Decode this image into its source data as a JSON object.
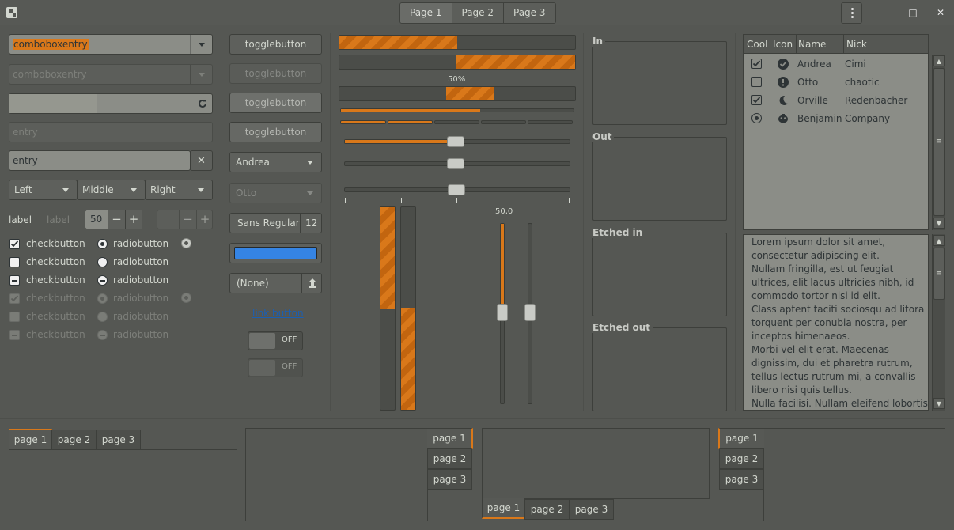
{
  "header": {
    "stack_tabs": [
      "Page 1",
      "Page 2",
      "Page 3"
    ],
    "window_buttons": {
      "minimize": "–",
      "maximize": "□",
      "close": "✕"
    }
  },
  "col1": {
    "combo1": "comboboxentry",
    "combo2": "comboboxentry",
    "entry_disabled": "entry",
    "entry_clear": "entry",
    "linked": [
      "Left",
      "Middle",
      "Right"
    ],
    "label1": "label",
    "label2": "label",
    "spin_value": "50",
    "spin_minus": "−",
    "spin_plus": "+",
    "checks": [
      "checkbutton",
      "checkbutton",
      "checkbutton",
      "checkbutton",
      "checkbutton",
      "checkbutton"
    ],
    "radios": [
      "radiobutton",
      "radiobutton",
      "radiobutton",
      "radiobutton",
      "radiobutton",
      "radiobutton"
    ]
  },
  "col2": {
    "toggles": [
      "togglebutton",
      "togglebutton",
      "togglebutton",
      "togglebutton"
    ],
    "combo_andrea": "Andrea",
    "combo_otto": "Otto",
    "font_name": "Sans Regular",
    "font_size": "12",
    "color_hex": "#3584e4",
    "file_none": "(None)",
    "link": "link button",
    "switch1": "OFF",
    "switch2": "OFF"
  },
  "col3": {
    "progress_label": "50%",
    "progress_top": 0.5,
    "vscale_label": "50,0"
  },
  "frames": [
    "In",
    "Out",
    "Etched in",
    "Etched out"
  ],
  "tree": {
    "columns": [
      "Cool",
      "Icon",
      "Name",
      "Nick"
    ],
    "rows": [
      {
        "cool": "check",
        "icon": "check-circle-icon",
        "name": "Andrea",
        "nick": "Cimi"
      },
      {
        "cool": "empty",
        "icon": "alert-circle-icon",
        "name": "Otto",
        "nick": "chaotic"
      },
      {
        "cool": "check",
        "icon": "moon-icon",
        "name": "Orville",
        "nick": "Redenbacher"
      },
      {
        "cool": "radio",
        "icon": "face-icon",
        "name": "Benjamin",
        "nick": "Company"
      }
    ]
  },
  "text_lines": [
    "Lorem ipsum dolor sit amet,",
    "consectetur adipiscing elit.",
    "Nullam fringilla, est ut feugiat",
    "ultrices, elit lacus ultricies nibh, id",
    "commodo tortor nisi id elit.",
    "Class aptent taciti sociosqu ad litora",
    "torquent per conubia nostra, per",
    "inceptos himenaeos.",
    "Morbi vel elit erat. Maecenas",
    "dignissim, dui et pharetra rutrum,",
    "tellus lectus rutrum mi, a convallis",
    "libero nisi quis tellus.",
    "Nulla facilisi. Nullam eleifend lobortis"
  ],
  "notebook_tabs": [
    "page 1",
    "page 2",
    "page 3"
  ],
  "colors": {
    "accent": "#d9781a",
    "bg": "#555753",
    "entry": "#8b8d87"
  }
}
